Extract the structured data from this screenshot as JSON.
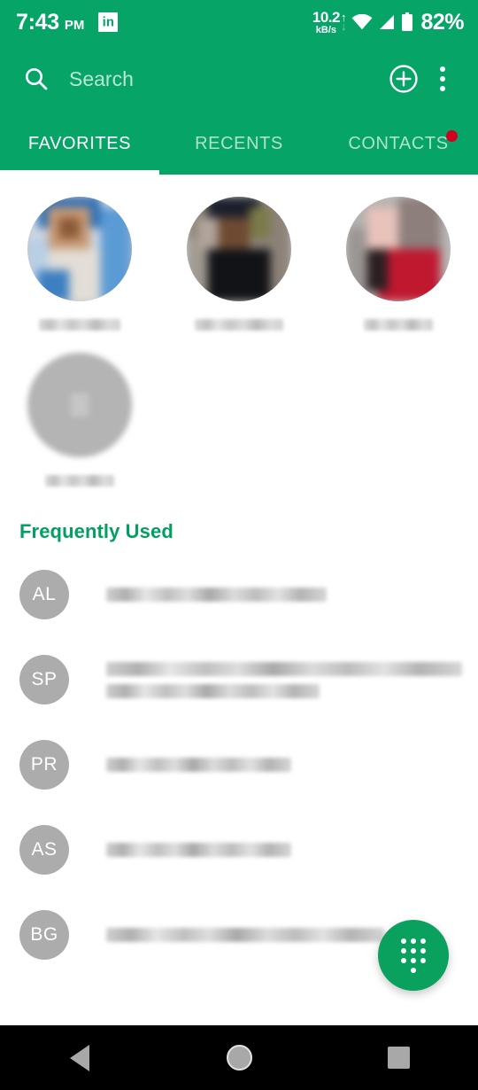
{
  "status_bar": {
    "time": "7:43",
    "ampm": "PM",
    "app_icon": "linkedin-icon",
    "network_rate": "10.2",
    "network_unit": "kB/s",
    "arrow_up": "↑",
    "arrow_down": "↓",
    "battery_percent": "82%",
    "wifi_icon": "wifi-icon",
    "signal_icon": "cell-signal-icon",
    "battery_icon": "battery-icon",
    "background_color": "#06A467"
  },
  "app_bar": {
    "search_placeholder": "Search",
    "search_value": "",
    "search_icon": "search-icon",
    "add_contact_icon": "add-circle-icon",
    "overflow_icon": "overflow-menu-icon"
  },
  "tabs": {
    "items": [
      {
        "label": "FAVORITES",
        "active": true,
        "badge": false
      },
      {
        "label": "RECENTS",
        "active": false,
        "badge": false
      },
      {
        "label": "CONTACTS",
        "active": false,
        "badge": true
      }
    ],
    "badge_color": "#D1001F",
    "active_indicator_color": "#FFFFFF"
  },
  "favorites": {
    "items": [
      {
        "type": "photo",
        "name_redacted": true,
        "name_width": "med"
      },
      {
        "type": "photo",
        "name_redacted": true,
        "name_width": "full"
      },
      {
        "type": "photo",
        "name_redacted": true,
        "name_width": "short"
      },
      {
        "type": "placeholder",
        "name_redacted": true,
        "name_width": "short"
      }
    ]
  },
  "frequently_used": {
    "header": "Frequently Used",
    "header_color": "#00A060",
    "rows": [
      {
        "initials": "AL",
        "lines": 1
      },
      {
        "initials": "SP",
        "lines": 2
      },
      {
        "initials": "PR",
        "lines": 1
      },
      {
        "initials": "AS",
        "lines": 1
      },
      {
        "initials": "BG",
        "lines": 1
      }
    ],
    "avatar_color": "#ACACAC"
  },
  "fab": {
    "icon": "dialpad-icon",
    "color": "#0AA05E"
  },
  "nav_bar": {
    "back_icon": "back-triangle-icon",
    "home_icon": "home-circle-icon",
    "recents_icon": "recents-square-icon",
    "background_color": "#000000"
  }
}
